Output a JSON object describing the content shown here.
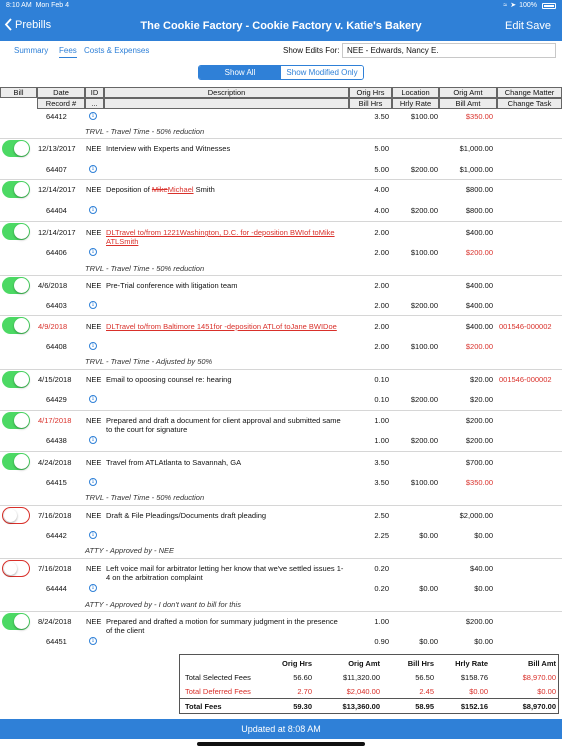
{
  "status": {
    "time": "8:10 AM",
    "date": "Mon Feb 4",
    "battery": "100%"
  },
  "nav": {
    "back": "Prebills",
    "title": "The Cookie Factory - Cookie Factory v. Katie's Bakery",
    "edit": "Edit",
    "save": "Save"
  },
  "tabs": [
    "Summary",
    "Fees",
    "Costs & Expenses"
  ],
  "show_edits": {
    "label": "Show Edits For:",
    "value": "NEE - Edwards, Nancy E."
  },
  "segment": {
    "all": "Show All",
    "modified": "Show Modified Only"
  },
  "headers": {
    "row1": [
      "Bill",
      "Date",
      "ID",
      "Description",
      "Orig Hrs",
      "Location",
      "Orig Amt",
      "Change Matter"
    ],
    "row2": [
      "Record #",
      "...",
      "Bill Hrs",
      "Hrly Rate",
      "Bill Amt",
      "Change Task"
    ]
  },
  "top_row": {
    "rec": "64412",
    "bhrs": "3.50",
    "rate": "$100.00",
    "bamt": "$350.00",
    "note": "TRVL - Travel Time - 50% reduction"
  },
  "entries": [
    {
      "date": "12/13/2017",
      "id": "NEE",
      "desc": "Interview with Experts and Witnesses",
      "ohrs": "5.00",
      "oamt": "$1,000.00",
      "cm": "",
      "rec": "64407",
      "bhrs": "5.00",
      "rate": "$200.00",
      "bamt": "$1,000.00",
      "note": ""
    },
    {
      "date": "12/14/2017",
      "id": "NEE",
      "desc": "Deposition of ",
      "desc_del": "Mike",
      "desc_ins": "Michael",
      "desc_end": " Smith",
      "ohrs": "4.00",
      "oamt": "$800.00",
      "cm": "",
      "rec": "64404",
      "bhrs": "4.00",
      "rate": "$200.00",
      "bamt": "$800.00",
      "note": ""
    },
    {
      "date": "12/14/2017",
      "id": "NEE",
      "desc": "DLTravel to/from 1221Washington, D.C. for -deposition BWIof toMike ATLSmith",
      "ohrs": "2.00",
      "oamt": "$400.00",
      "cm": "",
      "rec": "64406",
      "bhrs": "2.00",
      "rate": "$100.00",
      "bamt": "$200.00",
      "note": "TRVL - Travel Time - 50% reduction"
    },
    {
      "date": "4/6/2018",
      "id": "NEE",
      "desc": "Pre-Trial conference with litigation team",
      "ohrs": "2.00",
      "oamt": "$400.00",
      "cm": "",
      "rec": "64403",
      "bhrs": "2.00",
      "rate": "$200.00",
      "bamt": "$400.00",
      "note": ""
    },
    {
      "date": "4/9/2018",
      "id": "NEE",
      "desc": "DLTravel to/from Baltimore 1451for -deposition ATLof toJane BWIDoe",
      "ohrs": "2.00",
      "oamt": "$400.00",
      "cm": "001546-000002",
      "rec": "64408",
      "bhrs": "2.00",
      "rate": "$100.00",
      "bamt": "$200.00",
      "note": "TRVL - Travel Time - Adjusted by 50%"
    },
    {
      "date": "4/15/2018",
      "id": "NEE",
      "desc": "Email to opoosing counsel re: hearing",
      "ohrs": "0.10",
      "oamt": "$20.00",
      "cm": "001546-000002",
      "rec": "64429",
      "bhrs": "0.10",
      "rate": "$200.00",
      "bamt": "$20.00",
      "note": ""
    },
    {
      "date": "4/17/2018",
      "id": "NEE",
      "desc": "Prepared and draft a document for client approval and submitted same to the court for signature",
      "ohrs": "1.00",
      "oamt": "$200.00",
      "cm": "",
      "rec": "64438",
      "bhrs": "1.00",
      "rate": "$200.00",
      "bamt": "$200.00",
      "note": ""
    },
    {
      "date": "4/24/2018",
      "id": "NEE",
      "desc": "Travel from ATLAtlanta to Savannah, GA",
      "ohrs": "3.50",
      "oamt": "$700.00",
      "cm": "",
      "rec": "64415",
      "bhrs": "3.50",
      "rate": "$100.00",
      "bamt": "$350.00",
      "note": "TRVL - Travel Time - 50% reduction"
    },
    {
      "date": "7/16/2018",
      "id": "NEE",
      "desc": "Draft & File Pleadings/Documents draft pleading",
      "ohrs": "2.50",
      "oamt": "$2,000.00",
      "cm": "",
      "rec": "64442",
      "bhrs": "2.25",
      "rate": "$0.00",
      "bamt": "$0.00",
      "note": "ATTY - Approved by - NEE"
    },
    {
      "date": "7/16/2018",
      "id": "NEE",
      "desc": "Left voice mail for arbitrator letting her know that we've settled issues 1-4 on the arbitration complaint",
      "ohrs": "0.20",
      "oamt": "$40.00",
      "cm": "",
      "rec": "64444",
      "bhrs": "0.20",
      "rate": "$0.00",
      "bamt": "$0.00",
      "note": "ATTY - Approved by - I don't want to bill for this"
    },
    {
      "date": "8/24/2018",
      "id": "NEE",
      "desc": "Prepared and drafted a motion for summary judgment in the presence of the client",
      "ohrs": "1.00",
      "oamt": "$200.00",
      "cm": "",
      "rec": "64451",
      "bhrs": "0.90",
      "rate": "$0.00",
      "bamt": "$0.00",
      "note": ""
    }
  ],
  "totals": {
    "headers": [
      "Orig Hrs",
      "Orig Amt",
      "Bill Hrs",
      "Hrly Rate",
      "Bill Amt"
    ],
    "rows": [
      {
        "label": "Total Selected Fees",
        "vals": [
          "56.60",
          "$11,320.00",
          "56.50",
          "$158.76",
          "$8,970.00"
        ]
      },
      {
        "label": "Total Deferred Fees",
        "vals": [
          "2.70",
          "$2,040.00",
          "2.45",
          "$0.00",
          "$0.00"
        ]
      },
      {
        "label": "Total Fees",
        "vals": [
          "59.30",
          "$13,360.00",
          "58.95",
          "$152.16",
          "$8,970.00"
        ]
      }
    ]
  },
  "footer": "Updated at 8:08 AM",
  "colors": {
    "accent": "#2f80d7",
    "edit_red": "#d9302a",
    "toggle_green": "#4cd964"
  }
}
